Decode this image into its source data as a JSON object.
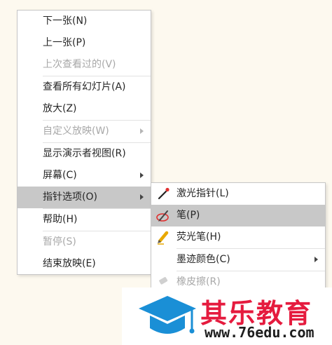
{
  "context_menu": {
    "items": [
      {
        "label": "下一张(N)"
      },
      {
        "label": "上一张(P)"
      },
      {
        "label": "上次查看过的(V)"
      },
      {
        "label": "查看所有幻灯片(A)"
      },
      {
        "label": "放大(Z)"
      },
      {
        "label": "自定义放映(W)"
      },
      {
        "label": "显示演示者视图(R)"
      },
      {
        "label": "屏幕(C)"
      },
      {
        "label": "指针选项(O)"
      },
      {
        "label": "帮助(H)"
      },
      {
        "label": "暂停(S)"
      },
      {
        "label": "结束放映(E)"
      }
    ]
  },
  "pointer_submenu": {
    "items": [
      {
        "label": "激光指针(L)",
        "icon": "laser-pointer-icon"
      },
      {
        "label": "笔(P)",
        "icon": "pen-icon"
      },
      {
        "label": "荧光笔(H)",
        "icon": "highlighter-icon"
      },
      {
        "label": "墨迹颜色(C)"
      },
      {
        "label": "橡皮擦(R)",
        "icon": "eraser-icon"
      }
    ]
  },
  "logo": {
    "text": "其乐教育",
    "url": "www.76edu.com"
  },
  "colors": {
    "highlight": "#c8c8c8",
    "disabled_text": "#a8a8a8",
    "brand_red": "#e51b3e",
    "brand_blue": "#1a8fd6"
  }
}
